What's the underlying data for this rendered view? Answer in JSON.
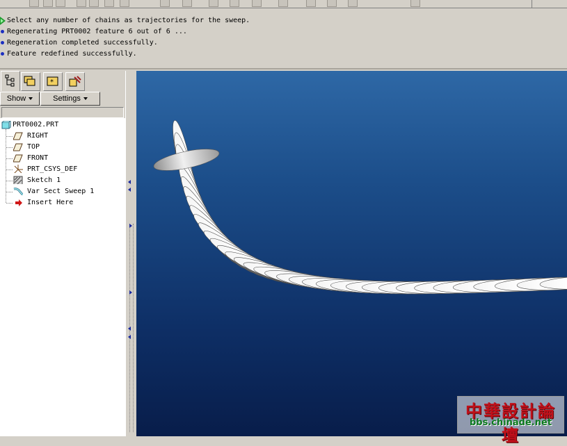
{
  "messages": [
    {
      "type": "prompt",
      "text": "Select any number of chains as trajectories for the sweep."
    },
    {
      "type": "info",
      "text": "Regenerating PRT0002 feature 6 out of 6 ..."
    },
    {
      "type": "info",
      "text": "Regeneration completed successfully."
    },
    {
      "type": "info",
      "text": "Feature redefined successfully."
    }
  ],
  "navigator": {
    "tabs": [
      {
        "icon": "model-tree-icon"
      },
      {
        "icon": "folder-browser-icon"
      },
      {
        "icon": "favorites-icon"
      },
      {
        "icon": "connections-icon"
      }
    ],
    "show_label": "Show",
    "settings_label": "Settings"
  },
  "model_tree": {
    "root": {
      "label": "PRT0002.PRT",
      "icon": "part-icon"
    },
    "items": [
      {
        "label": "RIGHT",
        "icon": "datum-plane-icon"
      },
      {
        "label": "TOP",
        "icon": "datum-plane-icon"
      },
      {
        "label": "FRONT",
        "icon": "datum-plane-icon"
      },
      {
        "label": "PRT_CSYS_DEF",
        "icon": "coordinate-system-icon"
      },
      {
        "label": "Sketch 1",
        "icon": "sketch-icon"
      },
      {
        "label": "Var Sect Sweep 1",
        "icon": "sweep-icon"
      },
      {
        "label": "Insert Here",
        "icon": "insert-arrow-icon"
      }
    ]
  },
  "watermark": {
    "title": "中華設計論壇",
    "url": "bbs.chinade.net"
  },
  "colors": {
    "viewport_top": "#2e68a6",
    "viewport_bottom": "#081d4a",
    "message_bullet": "#1c2fc0",
    "prompt_arrow": "#1f9a2e",
    "watermark_red": "#c0101a",
    "watermark_green": "#0c7a1e"
  }
}
